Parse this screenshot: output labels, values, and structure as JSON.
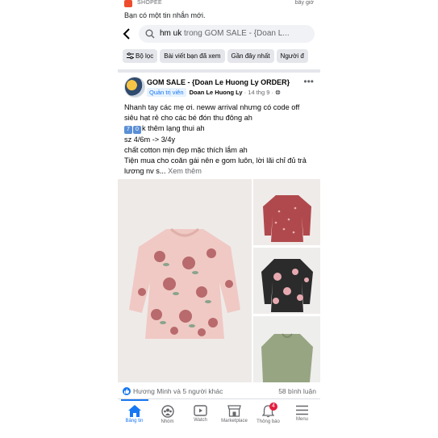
{
  "notification": {
    "app_name": "SHOPEE",
    "time": "bây giờ",
    "message": "Bạn có một tin nhắn mới."
  },
  "search": {
    "query": "hm uk",
    "scope": "trong GOM SALE - {Doan L..."
  },
  "filters": [
    "Bộ lọc",
    "Bài viết bạn đã xem",
    "Gần đây nhất",
    "Người đ"
  ],
  "post": {
    "group_name": "GOM SALE - {Doan Le Huong Ly ORDER}",
    "role_badge": "Quản trị viên",
    "author": "Doan Le Huong Ly",
    "date": "· 14 thg 9 ·",
    "lines": [
      "Nhanh tay các mẹ ơi. neww arrival nhưng có code off",
      "siêu hạt rẻ cho các bé đón thu đông ah",
      "k thêm lạng thui ah",
      "sz 4/6m -> 3/4y",
      "chất cotton mịn đẹp mặc thích lắm ah",
      "Tiện mua cho coăn gái nên e gom luôn, lời lãi chỉ đủ trả",
      "lương nv s..."
    ],
    "emoji_digits": [
      "7",
      "0"
    ],
    "see_more": "Xem thêm",
    "reactions_text": "Hương Minh và 5 người khác",
    "comments_text": "58 bình luận"
  },
  "colors": {
    "accent": "#1877f2",
    "badge": "#e41e3f",
    "chip_bg": "#e4e6eb"
  },
  "nav": {
    "items": [
      {
        "label": "Bảng tin",
        "icon": "home-icon"
      },
      {
        "label": "Nhóm",
        "icon": "groups-icon"
      },
      {
        "label": "Watch",
        "icon": "watch-icon"
      },
      {
        "label": "Marketplace",
        "icon": "marketplace-icon"
      },
      {
        "label": "Thông báo",
        "icon": "bell-icon"
      },
      {
        "label": "Menu",
        "icon": "menu-icon"
      }
    ],
    "notification_count": "4"
  }
}
